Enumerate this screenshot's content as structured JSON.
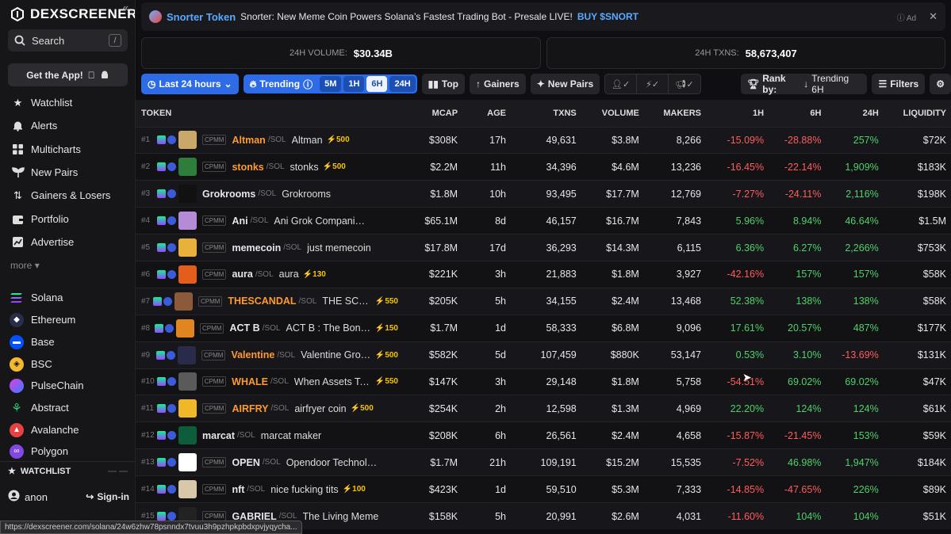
{
  "sidebar": {
    "logo_text": "DEXSCREENER",
    "search": {
      "label": "Search",
      "shortcut": "/"
    },
    "get_app": "Get the App!",
    "nav": [
      "Watchlist",
      "Alerts",
      "Multicharts",
      "New Pairs",
      "Gainers & Losers",
      "Portfolio",
      "Advertise"
    ],
    "more": "more",
    "chains": [
      {
        "name": "Solana",
        "color": "#9945ff"
      },
      {
        "name": "Ethereum",
        "color": "#627eea"
      },
      {
        "name": "Base",
        "color": "#0052ff"
      },
      {
        "name": "BSC",
        "color": "#f3ba2f"
      },
      {
        "name": "PulseChain",
        "color": "#e23de6"
      },
      {
        "name": "Abstract",
        "color": "#2ecc71"
      },
      {
        "name": "Avalanche",
        "color": "#e84142"
      },
      {
        "name": "Polygon",
        "color": "#8247e5"
      }
    ],
    "watchlist_label": "WATCHLIST",
    "user": "anon",
    "sign_in": "Sign-in"
  },
  "ad": {
    "brand": "Snorter Token",
    "text": "Snorter: New Meme Coin Powers Solana’s Fastest Trading Bot - Presale LIVE!",
    "cta": "BUY $SNORT",
    "tag": "Ad"
  },
  "stats": {
    "volume_label": "24H VOLUME:",
    "volume": "$30.34B",
    "txns_label": "24H TXNS:",
    "txns": "58,673,407"
  },
  "filters": {
    "timeframe": "Last 24 hours",
    "trending": "Trending",
    "tf_options": [
      "5M",
      "1H",
      "6H",
      "24H"
    ],
    "tf_active": "6H",
    "top": "Top",
    "gainers": "Gainers",
    "new_pairs": "New Pairs",
    "rank_by_label": "Rank by:",
    "rank_by_value": "Trending 6H",
    "filters": "Filters"
  },
  "table": {
    "headers": [
      "TOKEN",
      "MCAP",
      "AGE",
      "TXNS",
      "VOLUME",
      "MAKERS",
      "1H",
      "6H",
      "24H",
      "LIQUIDITY"
    ],
    "rows": [
      {
        "rank": "#1",
        "sym": "Altman",
        "orange": true,
        "pair": "/SOL",
        "name": "Altman",
        "boost": "500",
        "mcap": "$308K",
        "age": "17h",
        "txns": "49,631",
        "vol": "$3.8M",
        "makers": "8,266",
        "h1": "-15.09%",
        "h6": "-28.88%",
        "h24": "257%",
        "liq": "$72K",
        "av": "#c9a86a"
      },
      {
        "rank": "#2",
        "sym": "stonks",
        "orange": true,
        "pair": "/SOL",
        "name": "stonks",
        "boost": "500",
        "mcap": "$2.2M",
        "age": "11h",
        "txns": "34,396",
        "vol": "$4.6M",
        "makers": "13,236",
        "h1": "-16.45%",
        "h6": "-22.14%",
        "h24": "1,909%",
        "liq": "$183K",
        "av": "#2f7d3a"
      },
      {
        "rank": "#3",
        "sym": "Grokrooms",
        "orange": false,
        "pair": "/SOL",
        "name": "Grokrooms",
        "boost": "",
        "mcap": "$1.8M",
        "age": "10h",
        "txns": "93,495",
        "vol": "$17.7M",
        "makers": "12,769",
        "h1": "-7.27%",
        "h6": "-24.11%",
        "h24": "2,116%",
        "liq": "$198K",
        "av": "#111111"
      },
      {
        "rank": "#4",
        "sym": "Ani",
        "orange": false,
        "pair": "/SOL",
        "name": "Ani Grok Companion",
        "boost": "",
        "mcap": "$65.1M",
        "age": "8d",
        "txns": "46,157",
        "vol": "$16.7M",
        "makers": "7,843",
        "h1": "5.96%",
        "h6": "8.94%",
        "h24": "46.64%",
        "liq": "$1.5M",
        "av": "#b58bd8"
      },
      {
        "rank": "#5",
        "sym": "memecoin",
        "orange": false,
        "pair": "/SOL",
        "name": "just memecoin",
        "boost": "",
        "mcap": "$17.8M",
        "age": "17d",
        "txns": "36,293",
        "vol": "$14.3M",
        "makers": "6,115",
        "h1": "6.36%",
        "h6": "6.27%",
        "h24": "2,266%",
        "liq": "$753K",
        "av": "#e8b23a"
      },
      {
        "rank": "#6",
        "sym": "aura",
        "orange": false,
        "pair": "/SOL",
        "name": "aura",
        "boost": "130",
        "mcap": "$221K",
        "age": "3h",
        "txns": "21,883",
        "vol": "$1.8M",
        "makers": "3,927",
        "h1": "-42.16%",
        "h6": "157%",
        "h24": "157%",
        "liq": "$58K",
        "av": "#e35d1c"
      },
      {
        "rank": "#7",
        "sym": "THESCANDAL",
        "orange": true,
        "pair": "/SOL",
        "name": "THE SCANDAL",
        "boost": "550",
        "mcap": "$205K",
        "age": "5h",
        "txns": "34,155",
        "vol": "$2.4M",
        "makers": "13,468",
        "h1": "52.38%",
        "h6": "138%",
        "h24": "138%",
        "liq": "$58K",
        "av": "#8a5a3a"
      },
      {
        "rank": "#8",
        "sym": "ACT B",
        "orange": false,
        "pair": "/SOL",
        "name": "ACT B : The Bonk Prop",
        "boost": "150",
        "mcap": "$1.7M",
        "age": "1d",
        "txns": "58,333",
        "vol": "$6.8M",
        "makers": "9,096",
        "h1": "17.61%",
        "h6": "20.57%",
        "h24": "487%",
        "liq": "$177K",
        "av": "#e0851f"
      },
      {
        "rank": "#9",
        "sym": "Valentine",
        "orange": true,
        "pair": "/SOL",
        "name": "Valentine Grok C",
        "boost": "500",
        "mcap": "$582K",
        "age": "5d",
        "txns": "107,459",
        "vol": "$880K",
        "makers": "53,147",
        "h1": "0.53%",
        "h6": "3.10%",
        "h24": "-13.69%",
        "liq": "$131K",
        "av": "#2a2a4a"
      },
      {
        "rank": "#10",
        "sym": "WHALE",
        "orange": true,
        "pair": "/SOL",
        "name": "When Assets Take t",
        "boost": "550",
        "mcap": "$147K",
        "age": "3h",
        "txns": "29,148",
        "vol": "$1.8M",
        "makers": "5,758",
        "h1": "-54.51%",
        "h6": "69.02%",
        "h24": "69.02%",
        "liq": "$47K",
        "av": "#5a5a5a"
      },
      {
        "rank": "#11",
        "sym": "AIRFRY",
        "orange": true,
        "pair": "/SOL",
        "name": "airfryer coin",
        "boost": "500",
        "mcap": "$254K",
        "age": "2h",
        "txns": "12,598",
        "vol": "$1.3M",
        "makers": "4,969",
        "h1": "22.20%",
        "h6": "124%",
        "h24": "124%",
        "liq": "$61K",
        "av": "#f0b72a"
      },
      {
        "rank": "#12",
        "sym": "marcat",
        "orange": false,
        "pair": "/SOL",
        "name": "marcat maker",
        "boost": "",
        "mcap": "$208K",
        "age": "6h",
        "txns": "26,561",
        "vol": "$2.4M",
        "makers": "4,658",
        "h1": "-15.87%",
        "h6": "-21.45%",
        "h24": "153%",
        "liq": "$59K",
        "av": "#0d5c3a"
      },
      {
        "rank": "#13",
        "sym": "OPEN",
        "orange": false,
        "pair": "/SOL",
        "name": "Opendoor Technologies Inc",
        "boost": "",
        "mcap": "$1.7M",
        "age": "21h",
        "txns": "109,191",
        "vol": "$15.2M",
        "makers": "15,535",
        "h1": "-7.52%",
        "h6": "46.98%",
        "h24": "1,947%",
        "liq": "$184K",
        "av": "#ffffff"
      },
      {
        "rank": "#14",
        "sym": "nft",
        "orange": false,
        "pair": "/SOL",
        "name": "nice fucking tits",
        "boost": "100",
        "mcap": "$423K",
        "age": "1d",
        "txns": "59,510",
        "vol": "$5.3M",
        "makers": "7,333",
        "h1": "-14.85%",
        "h6": "-47.65%",
        "h24": "226%",
        "liq": "$89K",
        "av": "#d8c7a8"
      },
      {
        "rank": "#15",
        "sym": "GABRIEL",
        "orange": false,
        "pair": "/SOL",
        "name": "The Living Meme",
        "boost": "",
        "mcap": "$158K",
        "age": "5h",
        "txns": "20,991",
        "vol": "$2.6M",
        "makers": "4,031",
        "h1": "-11.60%",
        "h6": "104%",
        "h24": "104%",
        "liq": "$51K",
        "av": "#222222"
      }
    ]
  },
  "status_url": "https://dexscreener.com/solana/24w6zhw78psnndx7tvuu3h9pzhpkpbdxpvjyqycha..."
}
